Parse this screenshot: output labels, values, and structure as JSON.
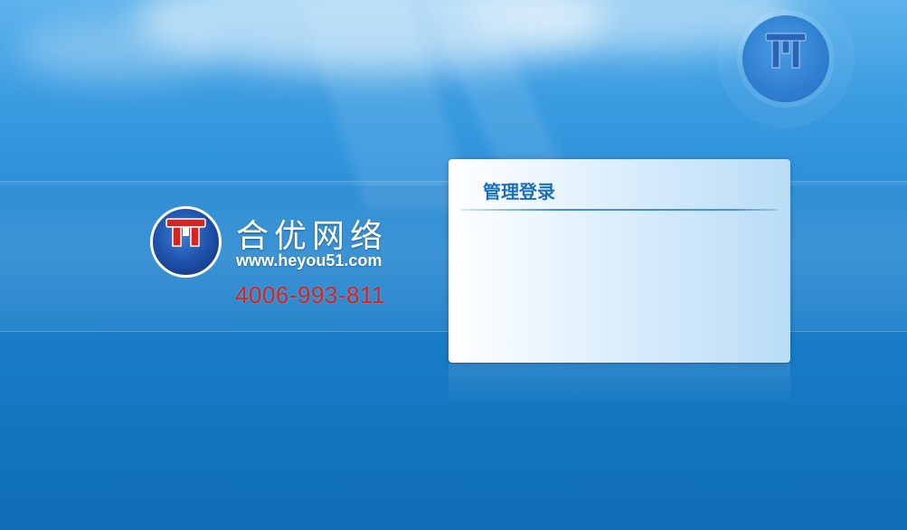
{
  "brand": {
    "name": "合优网络",
    "url": "www.heyou51.com",
    "phone": "4006-993-811"
  },
  "login": {
    "title": "管理登录"
  },
  "icons": {
    "brand_logo": "heyou-logo-icon",
    "corner_emblem": "heyou-emblem-icon"
  },
  "colors": {
    "background": "#1f86d2",
    "phone": "#d8231f",
    "login_title": "#1a6fb8",
    "logo_red": "#d8231f",
    "logo_blue": "#1d4fa8"
  }
}
